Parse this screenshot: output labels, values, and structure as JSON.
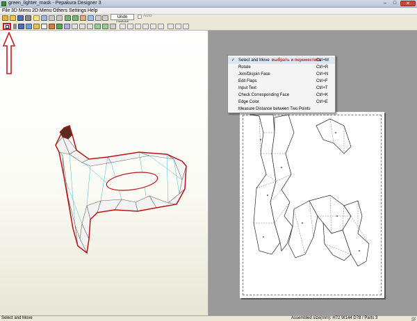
{
  "window": {
    "title": "green_lighter_mask - Pepakura Designer 3",
    "controls": {
      "minimize": "–",
      "maximize": "□",
      "close": "✕"
    }
  },
  "menubar": {
    "items": [
      "File",
      "3D Menu",
      "2D Menu",
      "Others",
      "Settings",
      "Help"
    ],
    "undo_label": "Undo Unfold",
    "auto_label": "Auto"
  },
  "toolbar": {
    "selected_tool": "select-and-move-icon"
  },
  "context_menu": {
    "items": [
      {
        "label": "Select and Move",
        "note": "выбрать и переместить",
        "shortcut": "Ctrl+M",
        "checked": "✓"
      },
      {
        "label": "Rotate",
        "shortcut": "Ctrl+R"
      },
      {
        "label": "Join/Disjoin Face",
        "shortcut": "Ctrl+N"
      },
      {
        "label": "Edit Flaps",
        "shortcut": "Ctrl+F"
      },
      {
        "label": "Input Text",
        "shortcut": "Ctrl+T"
      },
      {
        "label": "Check Corresponding Face",
        "shortcut": "Ctrl+K"
      },
      {
        "label": "Edge Color",
        "shortcut": "Ctrl+E"
      },
      {
        "label": "Measure Distance between Two Points",
        "shortcut": ""
      }
    ]
  },
  "statusbar": {
    "left": "Select and Move",
    "right": "Assembled size(mm): H72 W144 D78 / Parts 3"
  },
  "colors": {
    "highlight": "#d01818",
    "model_outline": "#c01010",
    "model_edges": "#40b8d8"
  }
}
